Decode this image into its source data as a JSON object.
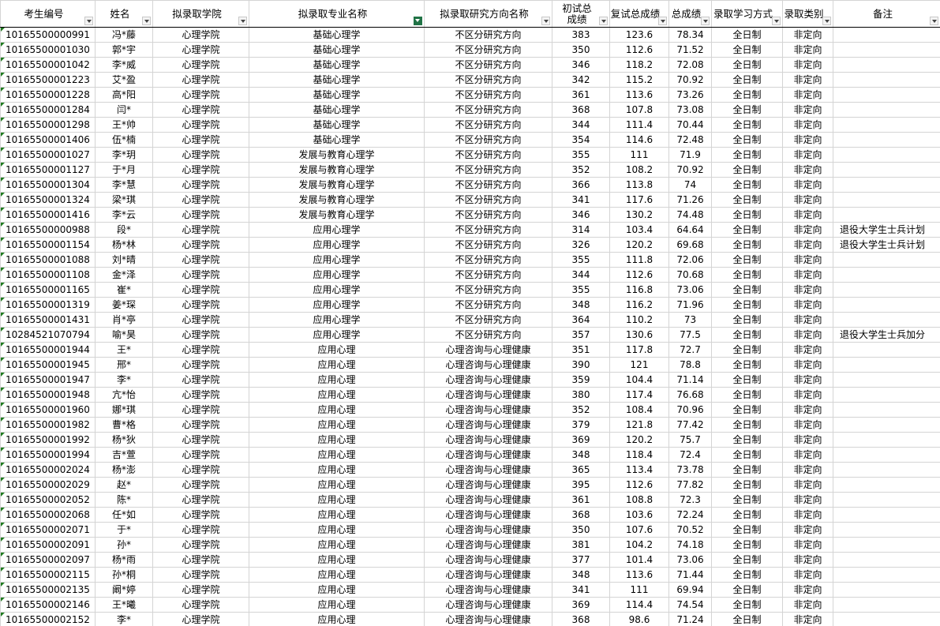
{
  "headers": [
    {
      "label": "考生编号",
      "filter_active": false
    },
    {
      "label": "姓名",
      "filter_active": false
    },
    {
      "label": "拟录取学院",
      "filter_active": false
    },
    {
      "label": "拟录取专业名称",
      "filter_active": true
    },
    {
      "label": "拟录取研究方向名称",
      "filter_active": false
    },
    {
      "label": "初试总\n成绩",
      "filter_active": false
    },
    {
      "label": "复试总成绩",
      "filter_active": false
    },
    {
      "label": "总成绩",
      "filter_active": false
    },
    {
      "label": "录取学习方式",
      "filter_active": false
    },
    {
      "label": "录取类别",
      "filter_active": false
    },
    {
      "label": "备注",
      "filter_active": false
    }
  ],
  "rows": [
    [
      "10165500000991",
      "冯*藤",
      "心理学院",
      "基础心理学",
      "不区分研究方向",
      "383",
      "123.6",
      "78.34",
      "全日制",
      "非定向",
      ""
    ],
    [
      "10165500001030",
      "郭*宇",
      "心理学院",
      "基础心理学",
      "不区分研究方向",
      "350",
      "112.6",
      "71.52",
      "全日制",
      "非定向",
      ""
    ],
    [
      "10165500001042",
      "李*威",
      "心理学院",
      "基础心理学",
      "不区分研究方向",
      "346",
      "118.2",
      "72.08",
      "全日制",
      "非定向",
      ""
    ],
    [
      "10165500001223",
      "艾*盈",
      "心理学院",
      "基础心理学",
      "不区分研究方向",
      "342",
      "115.2",
      "70.92",
      "全日制",
      "非定向",
      ""
    ],
    [
      "10165500001228",
      "高*阳",
      "心理学院",
      "基础心理学",
      "不区分研究方向",
      "361",
      "113.6",
      "73.26",
      "全日制",
      "非定向",
      ""
    ],
    [
      "10165500001284",
      "闫*",
      "心理学院",
      "基础心理学",
      "不区分研究方向",
      "368",
      "107.8",
      "73.08",
      "全日制",
      "非定向",
      ""
    ],
    [
      "10165500001298",
      "王*帅",
      "心理学院",
      "基础心理学",
      "不区分研究方向",
      "344",
      "111.4",
      "70.44",
      "全日制",
      "非定向",
      ""
    ],
    [
      "10165500001406",
      "伍*楠",
      "心理学院",
      "基础心理学",
      "不区分研究方向",
      "354",
      "114.6",
      "72.48",
      "全日制",
      "非定向",
      ""
    ],
    [
      "10165500001027",
      "李*玥",
      "心理学院",
      "发展与教育心理学",
      "不区分研究方向",
      "355",
      "111",
      "71.9",
      "全日制",
      "非定向",
      ""
    ],
    [
      "10165500001127",
      "于*月",
      "心理学院",
      "发展与教育心理学",
      "不区分研究方向",
      "352",
      "108.2",
      "70.92",
      "全日制",
      "非定向",
      ""
    ],
    [
      "10165500001304",
      "李*慧",
      "心理学院",
      "发展与教育心理学",
      "不区分研究方向",
      "366",
      "113.8",
      "74",
      "全日制",
      "非定向",
      ""
    ],
    [
      "10165500001324",
      "梁*琪",
      "心理学院",
      "发展与教育心理学",
      "不区分研究方向",
      "341",
      "117.6",
      "71.26",
      "全日制",
      "非定向",
      ""
    ],
    [
      "10165500001416",
      "李*云",
      "心理学院",
      "发展与教育心理学",
      "不区分研究方向",
      "346",
      "130.2",
      "74.48",
      "全日制",
      "非定向",
      ""
    ],
    [
      "10165500000988",
      "段*",
      "心理学院",
      "应用心理学",
      "不区分研究方向",
      "314",
      "103.4",
      "64.64",
      "全日制",
      "非定向",
      "退役大学生士兵计划"
    ],
    [
      "10165500001154",
      "杨*林",
      "心理学院",
      "应用心理学",
      "不区分研究方向",
      "326",
      "120.2",
      "69.68",
      "全日制",
      "非定向",
      "退役大学生士兵计划"
    ],
    [
      "10165500001088",
      "刘*晴",
      "心理学院",
      "应用心理学",
      "不区分研究方向",
      "355",
      "111.8",
      "72.06",
      "全日制",
      "非定向",
      ""
    ],
    [
      "10165500001108",
      "金*泽",
      "心理学院",
      "应用心理学",
      "不区分研究方向",
      "344",
      "112.6",
      "70.68",
      "全日制",
      "非定向",
      ""
    ],
    [
      "10165500001165",
      "崔*",
      "心理学院",
      "应用心理学",
      "不区分研究方向",
      "355",
      "116.8",
      "73.06",
      "全日制",
      "非定向",
      ""
    ],
    [
      "10165500001319",
      "姜*琛",
      "心理学院",
      "应用心理学",
      "不区分研究方向",
      "348",
      "116.2",
      "71.96",
      "全日制",
      "非定向",
      ""
    ],
    [
      "10165500001431",
      "肖*亭",
      "心理学院",
      "应用心理学",
      "不区分研究方向",
      "364",
      "110.2",
      "73",
      "全日制",
      "非定向",
      ""
    ],
    [
      "10284521070794",
      "喻*昊",
      "心理学院",
      "应用心理学",
      "不区分研究方向",
      "357",
      "130.6",
      "77.5",
      "全日制",
      "非定向",
      "退役大学生士兵加分"
    ],
    [
      "10165500001944",
      "王*",
      "心理学院",
      "应用心理",
      "心理咨询与心理健康",
      "351",
      "117.8",
      "72.7",
      "全日制",
      "非定向",
      ""
    ],
    [
      "10165500001945",
      "邢*",
      "心理学院",
      "应用心理",
      "心理咨询与心理健康",
      "390",
      "121",
      "78.8",
      "全日制",
      "非定向",
      ""
    ],
    [
      "10165500001947",
      "李*",
      "心理学院",
      "应用心理",
      "心理咨询与心理健康",
      "359",
      "104.4",
      "71.14",
      "全日制",
      "非定向",
      ""
    ],
    [
      "10165500001948",
      "亢*怡",
      "心理学院",
      "应用心理",
      "心理咨询与心理健康",
      "380",
      "117.4",
      "76.68",
      "全日制",
      "非定向",
      ""
    ],
    [
      "10165500001960",
      "娜*琪",
      "心理学院",
      "应用心理",
      "心理咨询与心理健康",
      "352",
      "108.4",
      "70.96",
      "全日制",
      "非定向",
      ""
    ],
    [
      "10165500001982",
      "曹*格",
      "心理学院",
      "应用心理",
      "心理咨询与心理健康",
      "379",
      "121.8",
      "77.42",
      "全日制",
      "非定向",
      ""
    ],
    [
      "10165500001992",
      "杨*狄",
      "心理学院",
      "应用心理",
      "心理咨询与心理健康",
      "369",
      "120.2",
      "75.7",
      "全日制",
      "非定向",
      ""
    ],
    [
      "10165500001994",
      "吉*萱",
      "心理学院",
      "应用心理",
      "心理咨询与心理健康",
      "348",
      "118.4",
      "72.4",
      "全日制",
      "非定向",
      ""
    ],
    [
      "10165500002024",
      "杨*澎",
      "心理学院",
      "应用心理",
      "心理咨询与心理健康",
      "365",
      "113.4",
      "73.78",
      "全日制",
      "非定向",
      ""
    ],
    [
      "10165500002029",
      "赵*",
      "心理学院",
      "应用心理",
      "心理咨询与心理健康",
      "395",
      "112.6",
      "77.82",
      "全日制",
      "非定向",
      ""
    ],
    [
      "10165500002052",
      "陈*",
      "心理学院",
      "应用心理",
      "心理咨询与心理健康",
      "361",
      "108.8",
      "72.3",
      "全日制",
      "非定向",
      ""
    ],
    [
      "10165500002068",
      "任*如",
      "心理学院",
      "应用心理",
      "心理咨询与心理健康",
      "368",
      "103.6",
      "72.24",
      "全日制",
      "非定向",
      ""
    ],
    [
      "10165500002071",
      "于*",
      "心理学院",
      "应用心理",
      "心理咨询与心理健康",
      "350",
      "107.6",
      "70.52",
      "全日制",
      "非定向",
      ""
    ],
    [
      "10165500002091",
      "孙*",
      "心理学院",
      "应用心理",
      "心理咨询与心理健康",
      "381",
      "104.2",
      "74.18",
      "全日制",
      "非定向",
      ""
    ],
    [
      "10165500002097",
      "杨*雨",
      "心理学院",
      "应用心理",
      "心理咨询与心理健康",
      "377",
      "101.4",
      "73.06",
      "全日制",
      "非定向",
      ""
    ],
    [
      "10165500002115",
      "孙*桐",
      "心理学院",
      "应用心理",
      "心理咨询与心理健康",
      "348",
      "113.6",
      "71.44",
      "全日制",
      "非定向",
      ""
    ],
    [
      "10165500002135",
      "阚*婷",
      "心理学院",
      "应用心理",
      "心理咨询与心理健康",
      "341",
      "111",
      "69.94",
      "全日制",
      "非定向",
      ""
    ],
    [
      "10165500002146",
      "王*曦",
      "心理学院",
      "应用心理",
      "心理咨询与心理健康",
      "369",
      "114.4",
      "74.54",
      "全日制",
      "非定向",
      ""
    ],
    [
      "10165500002152",
      "李*",
      "心理学院",
      "应用心理",
      "心理咨询与心理健康",
      "368",
      "98.6",
      "71.24",
      "全日制",
      "非定向",
      ""
    ]
  ]
}
